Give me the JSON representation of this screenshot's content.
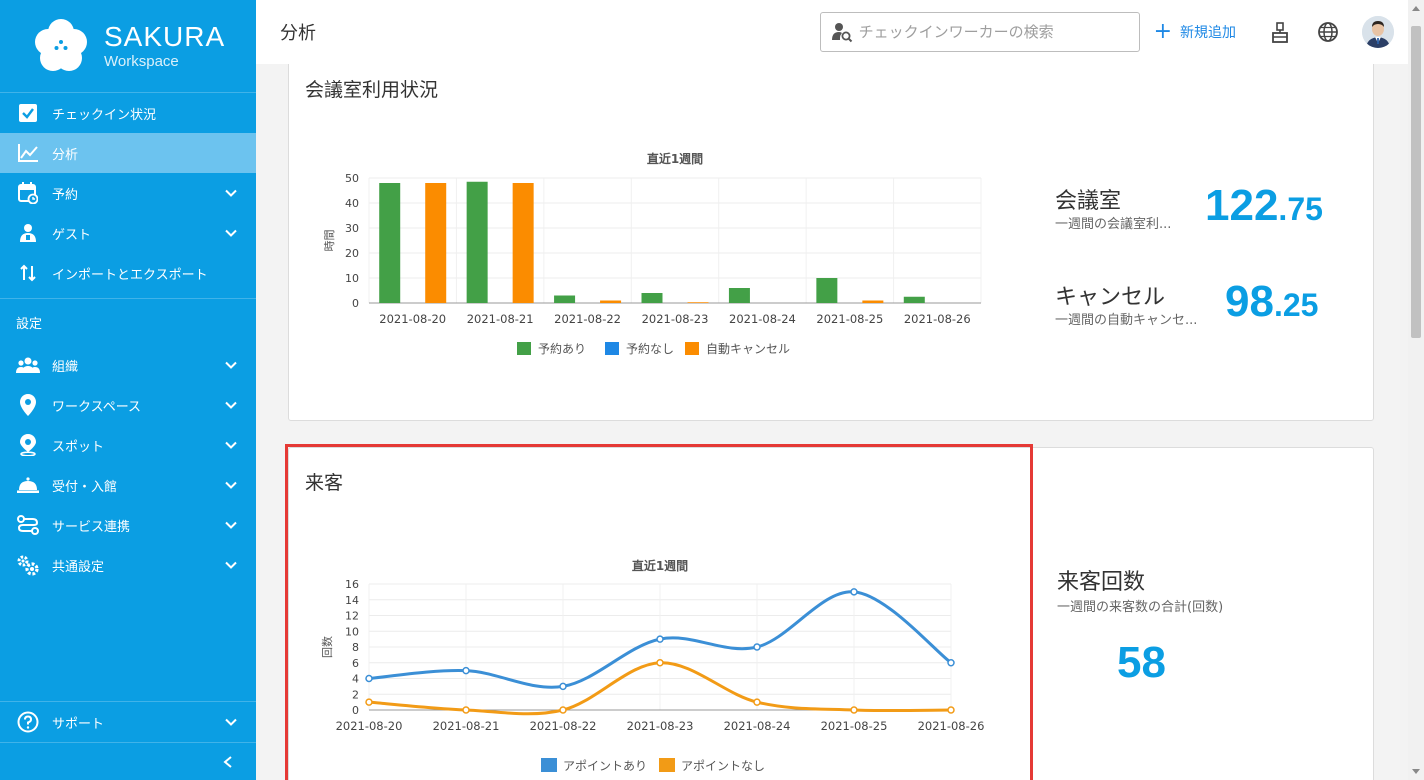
{
  "app": {
    "brand_title": "SAKURA",
    "brand_sub": "Workspace"
  },
  "sidebar": {
    "items": [
      {
        "label": "チェックイン状況",
        "icon": "checkbox-icon"
      },
      {
        "label": "分析",
        "icon": "analytics-icon"
      },
      {
        "label": "予約",
        "icon": "calendar-icon"
      },
      {
        "label": "ゲスト",
        "icon": "guest-icon"
      },
      {
        "label": "インポートとエクスポート",
        "icon": "import-export-icon"
      }
    ],
    "section_label": "設定",
    "settings_items": [
      {
        "label": "組織",
        "icon": "people-icon"
      },
      {
        "label": "ワークスペース",
        "icon": "location-pin-icon"
      },
      {
        "label": "スポット",
        "icon": "spot-pin-icon"
      },
      {
        "label": "受付・入館",
        "icon": "reception-bell-icon"
      },
      {
        "label": "サービス連携",
        "icon": "service-link-icon"
      },
      {
        "label": "共通設定",
        "icon": "gears-icon"
      }
    ],
    "support_label": "サポート"
  },
  "header": {
    "title": "分析",
    "search_placeholder": "チェックインワーカーの検索",
    "add_label": "新規追加"
  },
  "meeting_card": {
    "title": "会議室利用状況",
    "stat1_label": "会議室",
    "stat1_sub": "一週間の会議室利...",
    "stat1_int": "122",
    "stat1_dec": ".75",
    "stat2_label": "キャンセル",
    "stat2_sub": "一週間の自動キャンセ...",
    "stat2_int": "98",
    "stat2_dec": ".25"
  },
  "visitor_card": {
    "title": "来客",
    "stat_label": "来客回数",
    "stat_sub": "一週間の来客数の合計(回数)",
    "stat_value": "58"
  },
  "colors": {
    "accent": "#0b9ee3",
    "green": "#43a047",
    "orange": "#fb8c00",
    "blue": "#1e88e5",
    "line_blue": "#3b8fd6",
    "line_orange": "#f29b16",
    "highlight": "#e53935"
  },
  "chart_data": [
    {
      "type": "bar",
      "title": "直近1週間",
      "ylabel": "時間",
      "xlabel": "",
      "ylim": [
        0,
        50
      ],
      "yticks": [
        0,
        10,
        20,
        30,
        40,
        50
      ],
      "categories": [
        "2021-08-20",
        "2021-08-21",
        "2021-08-22",
        "2021-08-23",
        "2021-08-24",
        "2021-08-25",
        "2021-08-26"
      ],
      "series": [
        {
          "name": "予約あり",
          "color": "#43a047",
          "values": [
            48,
            48.5,
            3,
            4,
            6,
            10,
            2.5
          ]
        },
        {
          "name": "予約なし",
          "color": "#1e88e5",
          "values": [
            0,
            0,
            0,
            0,
            0,
            0,
            0
          ]
        },
        {
          "name": "自動キャンセル",
          "color": "#fb8c00",
          "values": [
            48,
            48,
            1,
            0.3,
            0,
            1,
            0
          ]
        }
      ],
      "grid": true,
      "legend": "bottom"
    },
    {
      "type": "line",
      "title": "直近1週間",
      "ylabel": "回数",
      "xlabel": "",
      "ylim": [
        0,
        16
      ],
      "yticks": [
        0,
        2,
        4,
        6,
        8,
        10,
        12,
        14,
        16
      ],
      "categories": [
        "2021-08-20",
        "2021-08-21",
        "2021-08-22",
        "2021-08-23",
        "2021-08-24",
        "2021-08-25",
        "2021-08-26"
      ],
      "series": [
        {
          "name": "アポイントあり",
          "color": "#3b8fd6",
          "values": [
            4,
            5,
            3,
            9,
            8,
            15,
            6
          ]
        },
        {
          "name": "アポイントなし",
          "color": "#f29b16",
          "values": [
            1,
            0,
            0,
            6,
            1,
            0,
            0
          ]
        }
      ],
      "grid": true,
      "legend": "bottom"
    }
  ]
}
